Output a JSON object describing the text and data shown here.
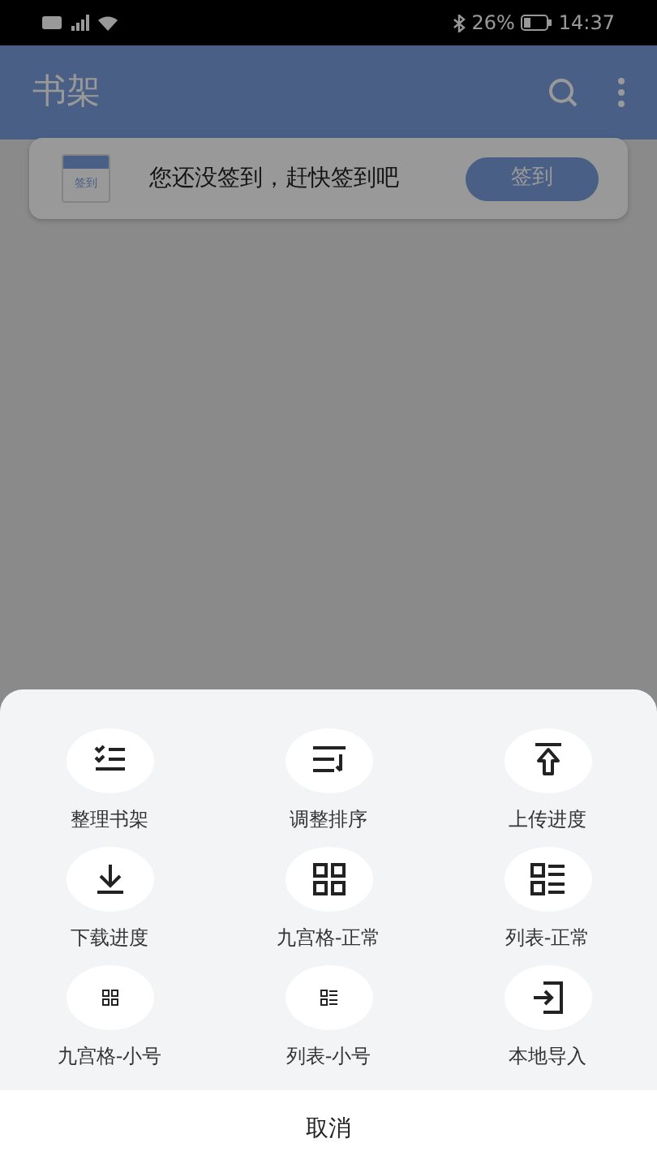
{
  "status_bar": {
    "battery": "26%",
    "time": "14:37"
  },
  "app_bar": {
    "title": "书架"
  },
  "sign_in_card": {
    "icon_label": "签到",
    "message": "您还没签到，赶快签到吧",
    "button": "签到"
  },
  "menu_sheet": {
    "items": [
      {
        "kind": "organize",
        "label": "整理书架"
      },
      {
        "kind": "sort",
        "label": "调整排序"
      },
      {
        "kind": "upload",
        "label": "上传进度"
      },
      {
        "kind": "download",
        "label": "下载进度"
      },
      {
        "kind": "grid",
        "label": "九宫格-正常"
      },
      {
        "kind": "list",
        "label": "列表-正常"
      },
      {
        "kind": "grid-small",
        "label": "九宫格-小号"
      },
      {
        "kind": "list-small",
        "label": "列表-小号"
      },
      {
        "kind": "import",
        "label": "本地导入"
      }
    ],
    "cancel": "取消"
  }
}
